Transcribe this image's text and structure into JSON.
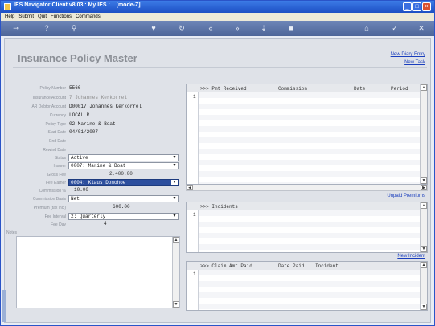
{
  "window": {
    "title": "IES Navigator Client v8.03 : My IES :",
    "mode": "[mode-Z]"
  },
  "menu": [
    "Help",
    "Submit",
    "Quit",
    "Functions",
    "Commands"
  ],
  "page": {
    "title": "Insurance Policy Master",
    "links": {
      "new_diary": "New Diary Entry",
      "new_task": "New Task"
    }
  },
  "form": {
    "policy_number": {
      "label": "Policy Number",
      "value": "5566"
    },
    "insurance_account": {
      "label": "Insurance Account",
      "value": "7 Johannes Kerkorrel"
    },
    "ar_debtor_account": {
      "label": "AR Debtor Account",
      "value": "D00017 Johannes Kerkorrel"
    },
    "currency": {
      "label": "Currency",
      "value": "LOCAL R"
    },
    "policy_type": {
      "label": "Policy Type",
      "value": "02 Marine & Boat"
    },
    "start_date": {
      "label": "Start Date",
      "value": "04/01/2007"
    },
    "end_date": {
      "label": "End Date",
      "value": ""
    },
    "rewind_date": {
      "label": "Rewind Date",
      "value": ""
    },
    "status": {
      "label": "Status",
      "value": "Active"
    },
    "insurer": {
      "label": "Insurer",
      "value": "0007: Marine & Boat"
    },
    "gross_fee": {
      "label": "Gross Fee",
      "value": "2,400.00"
    },
    "fee_earner": {
      "label": "Fee Earner",
      "value": "0004: Klaus Donohoe"
    },
    "commission_pct": {
      "label": "Commission %",
      "value": "10.00"
    },
    "commission_basis": {
      "label": "Commission Basis",
      "value": "Net"
    },
    "premium": {
      "label": "Premium (tax incl)",
      "value": "600.00"
    },
    "fee_interval": {
      "label": "Fee Interval",
      "value": "2: Quarterly"
    },
    "fee_day": {
      "label": "Fee Day",
      "value": "4"
    },
    "notes": {
      "label": "Notes",
      "value": ""
    }
  },
  "grid_payments": {
    "columns": [
      ">>> Pmt Received",
      "Commission",
      "Date",
      "Period"
    ],
    "row_num": "1"
  },
  "link_unpaid": "Unpaid Premiums",
  "grid_incidents": {
    "columns": [
      ">>> Incidents"
    ],
    "row_num": "1"
  },
  "link_new_incident": "New Incident",
  "grid_claims": {
    "columns": [
      ">>> Claim Amt Paid",
      "Date Paid",
      "Incident"
    ],
    "row_num": "1"
  },
  "icons": {
    "toolbar": [
      "key-icon",
      "help-icon",
      "search-icon",
      "heart-icon",
      "arrow-left-icon",
      "rewind-icon",
      "forward-icon",
      "pin-icon",
      "stop-icon",
      "home-icon",
      "check-icon",
      "close-icon"
    ]
  }
}
